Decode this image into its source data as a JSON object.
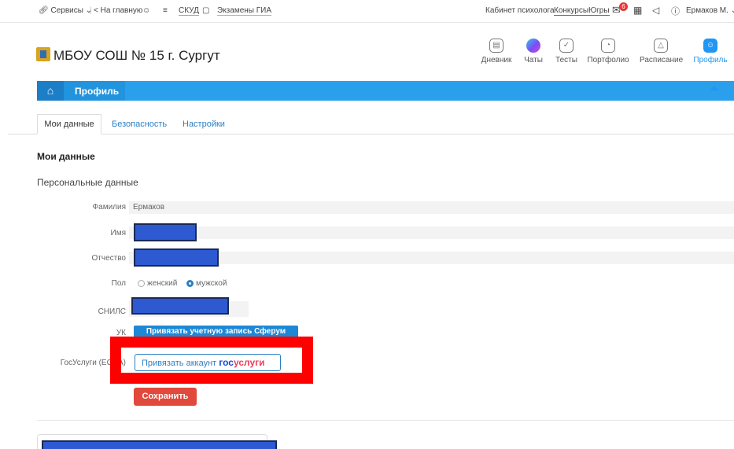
{
  "topbar": {
    "services": "Сервисы",
    "home": "< На главную",
    "skud": "СКУД",
    "exams": "Экзамены ГИА",
    "psych": "Кабинет психолога",
    "contests": "КонкурсыЮгры",
    "mail_badge": "6",
    "user": "Ермаков М."
  },
  "header": {
    "school": "МБОУ СОШ № 15 г. Сургут",
    "nav": [
      {
        "label": "Дневник",
        "icon": "diary-icon"
      },
      {
        "label": "Чаты",
        "icon": "chats-icon"
      },
      {
        "label": "Тесты",
        "icon": "tests-icon"
      },
      {
        "label": "Портфолио",
        "icon": "portfolio-icon"
      },
      {
        "label": "Расписание",
        "icon": "bell-icon"
      },
      {
        "label": "Профиль",
        "icon": "profile-icon"
      }
    ]
  },
  "band": {
    "title": "Профиль"
  },
  "tabs": [
    "Мои данные",
    "Безопасность",
    "Настройки"
  ],
  "content": {
    "title": "Мои данные",
    "subtitle": "Персональные данные",
    "labels": {
      "surname": "Фамилия",
      "name": "Имя",
      "patronymic": "Отчество",
      "gender": "Пол",
      "snils": "СНИЛС",
      "uk": "УК",
      "gosuslugi": "ГосУслуги (ЕСИА)"
    },
    "surname_value": "Ермаков",
    "gender_female": "женский",
    "gender_male": "мужской",
    "link_sferum": "Привязать учетную запись Сферум",
    "gos_button": "Привязать аккаунт",
    "gos_logo_1": "гос",
    "gos_logo_2": "услуги",
    "save": "Сохранить"
  },
  "colors": {
    "accent": "#2aa0ec",
    "save": "#e0493b",
    "highlight": "#ff0000"
  }
}
